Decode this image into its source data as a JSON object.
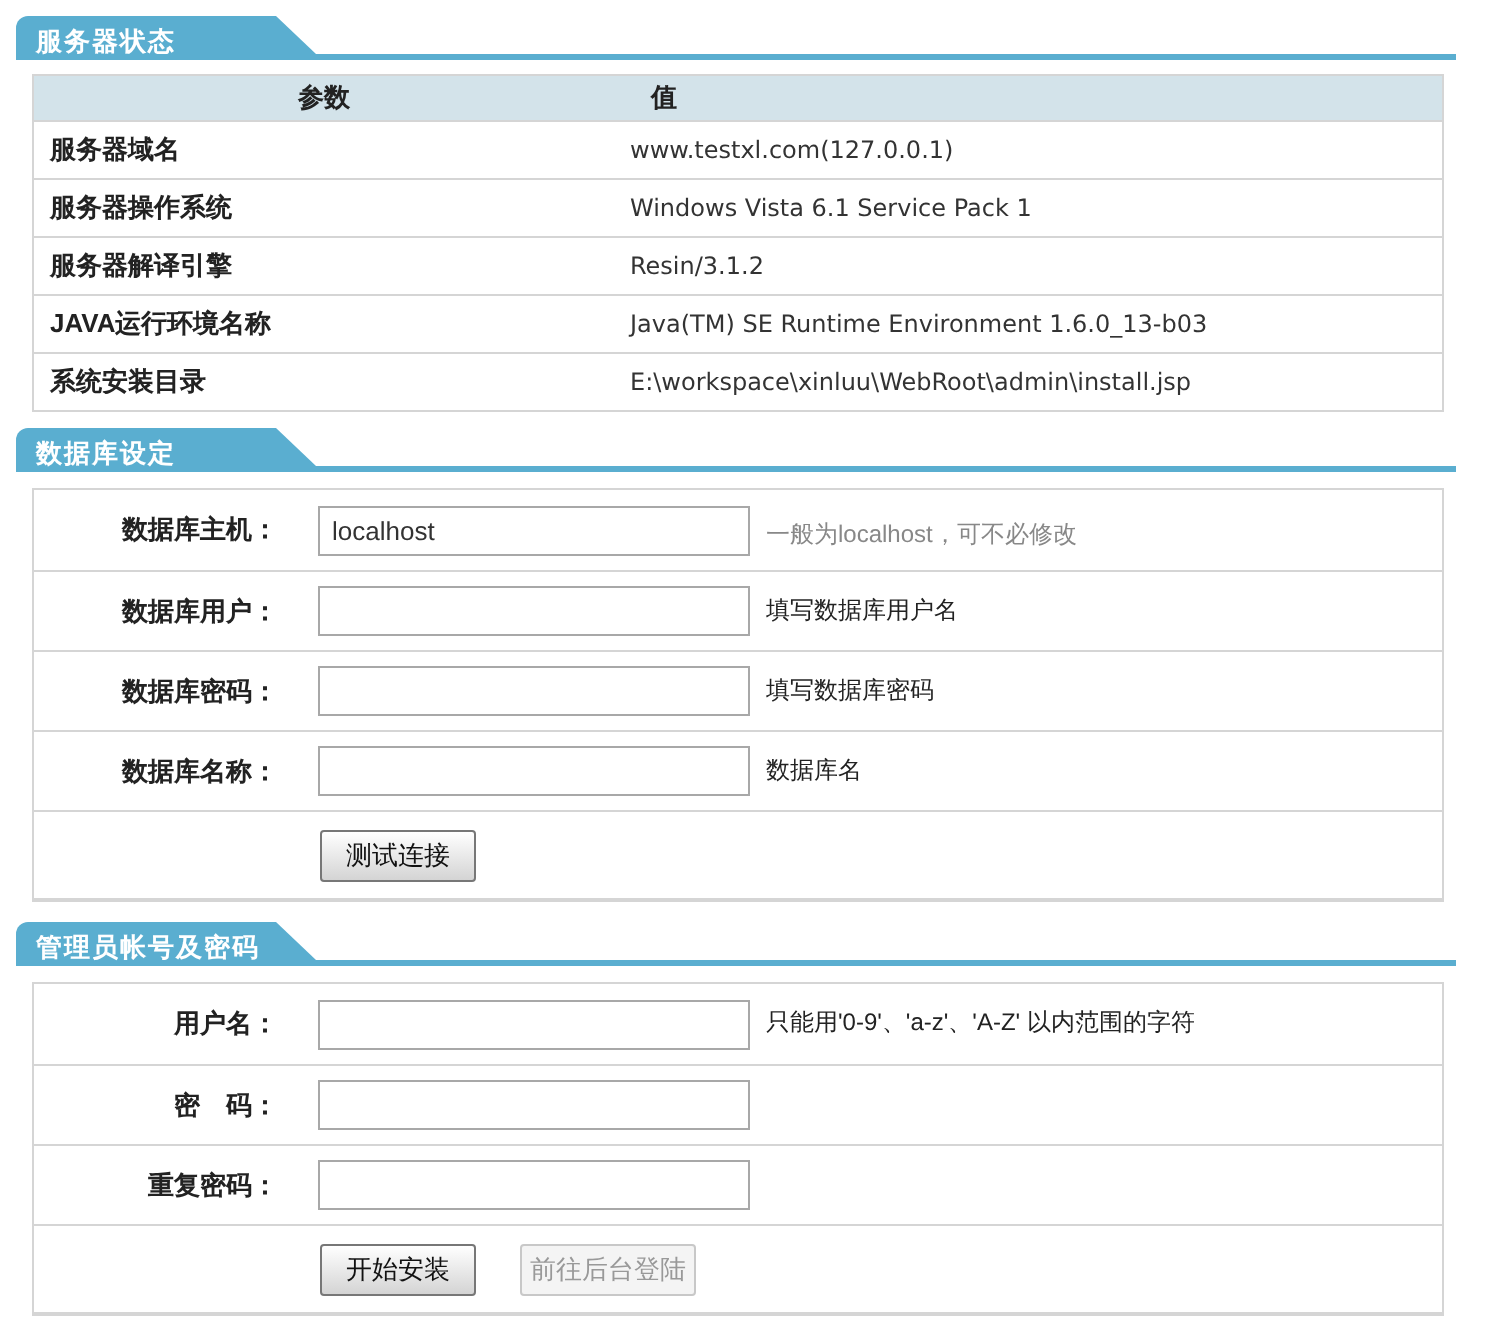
{
  "server_status": {
    "title": "服务器状态",
    "columns": [
      "参数",
      "值"
    ],
    "rows": [
      {
        "param": "服务器域名",
        "value": "www.testxl.com(127.0.0.1)"
      },
      {
        "param": "服务器操作系统",
        "value": "Windows Vista 6.1 Service Pack 1"
      },
      {
        "param": "服务器解译引擎",
        "value": "Resin/3.1.2"
      },
      {
        "param": "JAVA运行环境名称",
        "value": "Java(TM) SE Runtime Environment 1.6.0_13-b03"
      },
      {
        "param": "系统安装目录",
        "value": "E:\\workspace\\xinluu\\WebRoot\\admin\\install.jsp"
      }
    ]
  },
  "database": {
    "title": "数据库设定",
    "fields": [
      {
        "label": "数据库主机：",
        "value": "localhost",
        "hint": "一般为localhost，可不必修改",
        "hint_muted": true
      },
      {
        "label": "数据库用户：",
        "hint": "填写数据库用户名",
        "hint_muted": false
      },
      {
        "label": "数据库密码：",
        "hint": "填写数据库密码",
        "hint_muted": false
      },
      {
        "label": "数据库名称：",
        "hint": "数据库名",
        "hint_muted": false
      }
    ],
    "buttons": [
      {
        "label": "测试连接",
        "disabled": false
      }
    ]
  },
  "admin": {
    "title": "管理员帐号及密码",
    "fields": [
      {
        "label": "用户名：",
        "hint": "只能用'0-9'、'a-z'、'A-Z' 以内范围的字符",
        "hint_muted": false
      },
      {
        "label": "密　码："
      },
      {
        "label": "重复密码："
      }
    ],
    "buttons": [
      {
        "label": "开始安装",
        "disabled": false
      },
      {
        "label": "前往后台登陆",
        "disabled": true
      }
    ]
  }
}
